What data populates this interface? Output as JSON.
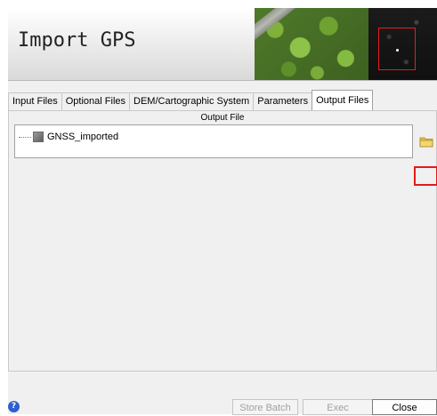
{
  "window": {
    "title": "Import GPS"
  },
  "tabs": [
    {
      "label": "Input Files",
      "active": false
    },
    {
      "label": "Optional Files",
      "active": false
    },
    {
      "label": "DEM/Cartographic System",
      "active": false
    },
    {
      "label": "Parameters",
      "active": false
    },
    {
      "label": "Output Files",
      "active": true
    }
  ],
  "output_panel": {
    "column_header": "Output File",
    "items": [
      {
        "label": "GNSS_imported",
        "icon": "raster-layer-icon"
      }
    ],
    "browse_icon": "folder-icon"
  },
  "footer": {
    "help_glyph": "?",
    "store_batch_label": "Store Batch",
    "exec_label": "Exec",
    "close_label": "Close"
  },
  "colors": {
    "highlight_red": "#e21b1b",
    "help_blue": "#2c5fd0"
  }
}
